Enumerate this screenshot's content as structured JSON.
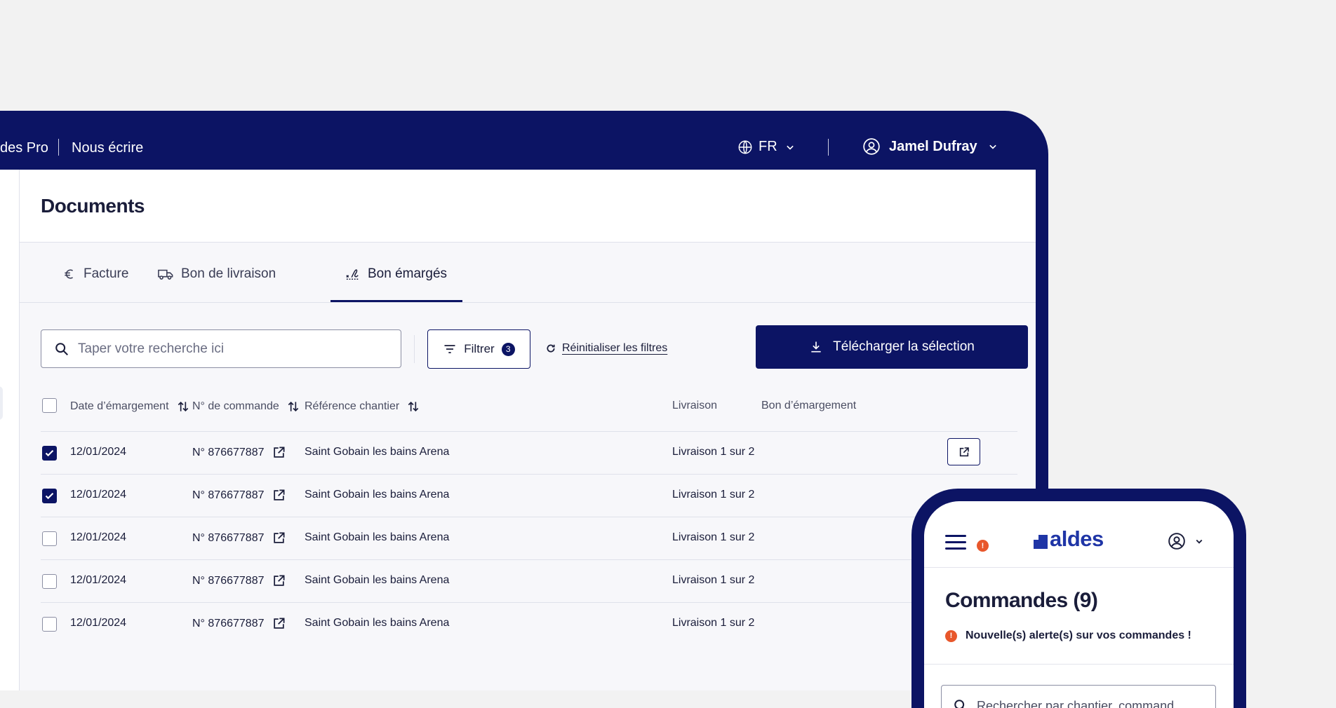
{
  "topnav": {
    "link_pro": "des Pro",
    "link_contact": "Nous écrire",
    "language": "FR",
    "user_name": "Jamel Dufray"
  },
  "page": {
    "title": "Documents"
  },
  "tabs": [
    {
      "label": "Facture",
      "icon": "euro-icon",
      "active": false
    },
    {
      "label": "Bon de livraison",
      "icon": "truck-icon",
      "active": false
    },
    {
      "label": "Bon émargés",
      "icon": "signature-icon",
      "active": true
    }
  ],
  "toolbar": {
    "search_placeholder": "Taper votre recherche ici",
    "filter_label": "Filtrer",
    "filter_count": "3",
    "reset_label": "Réinitialiser les filtres",
    "download_label": "Télécharger la sélection"
  },
  "table": {
    "columns": [
      "Date d’émargement",
      "N° de commande",
      "Référence chantier",
      "Livraison",
      "Bon d’émargement"
    ],
    "rows": [
      {
        "checked": true,
        "date": "12/01/2024",
        "order": "N° 876677887",
        "site": "Saint Gobain les bains Arena",
        "delivery": "Livraison 1 sur 2"
      },
      {
        "checked": true,
        "date": "12/01/2024",
        "order": "N° 876677887",
        "site": "Saint Gobain les bains Arena",
        "delivery": "Livraison 1 sur 2"
      },
      {
        "checked": false,
        "date": "12/01/2024",
        "order": "N° 876677887",
        "site": "Saint Gobain les bains Arena",
        "delivery": "Livraison 1 sur 2"
      },
      {
        "checked": false,
        "date": "12/01/2024",
        "order": "N° 876677887",
        "site": "Saint Gobain les bains Arena",
        "delivery": "Livraison 1 sur 2"
      },
      {
        "checked": false,
        "date": "12/01/2024",
        "order": "N° 876677887",
        "site": "Saint Gobain les bains Arena",
        "delivery": "Livraison 1 sur 2"
      }
    ]
  },
  "mobile": {
    "logo_text": "aldes",
    "alert_badge": "!",
    "title": "Commandes (9)",
    "alert_message": "Nouvelle(s) alerte(s) sur vos commandes !",
    "search_placeholder": "Rechercher par chantier, command"
  },
  "colors": {
    "brand_navy": "#0c1464",
    "logo_blue": "#1f35a6",
    "alert_orange": "#e8572b",
    "background": "#f2f2f2"
  }
}
